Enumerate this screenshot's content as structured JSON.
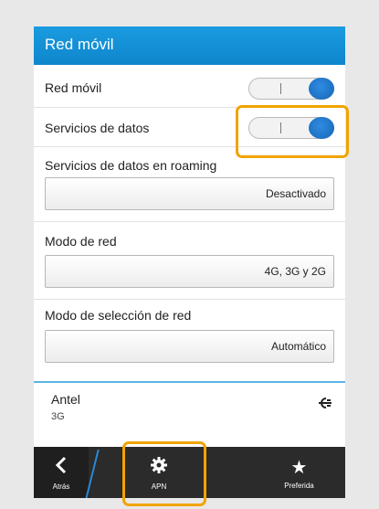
{
  "header": {
    "title": "Red móvil"
  },
  "settings": {
    "red_movil": {
      "label": "Red móvil",
      "state": "on"
    },
    "servicios_datos": {
      "label": "Servicios de datos",
      "state": "on"
    },
    "roaming": {
      "label": "Servicios de datos en roaming",
      "value": "Desactivado"
    },
    "modo_red": {
      "label": "Modo de red",
      "value": "4G, 3G y 2G"
    },
    "modo_seleccion": {
      "label": "Modo de selección de red",
      "value": "Automático"
    }
  },
  "network": {
    "name": "Antel",
    "type": "3G",
    "icon": "connector-icon"
  },
  "actionbar": {
    "back_label": "Atrás",
    "apn_label": "APN",
    "pref_label": "Preferida"
  },
  "colors": {
    "title_bar": "#1a9be0",
    "toggle_on": "#1f74c8",
    "highlight": "#f0a400",
    "actionbar": "#2b2b2b"
  }
}
